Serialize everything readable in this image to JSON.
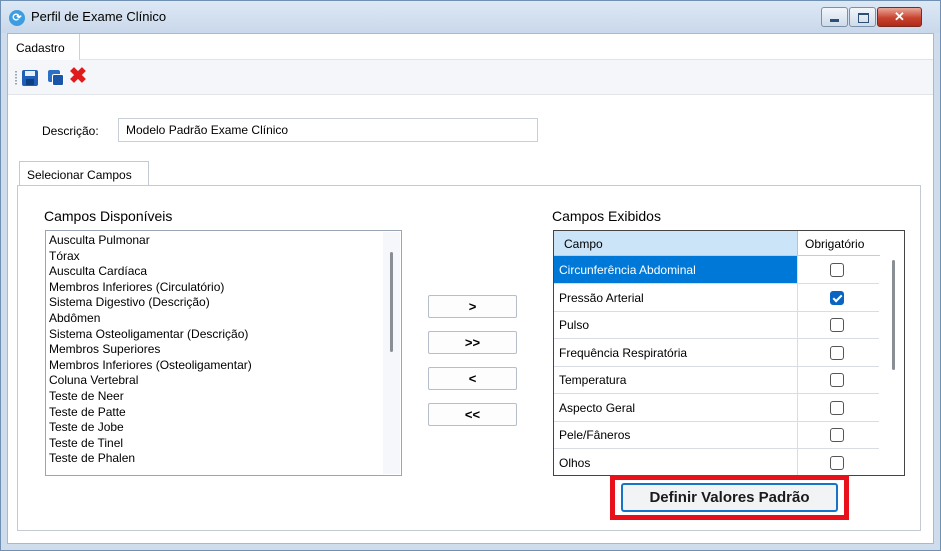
{
  "window": {
    "title": "Perfil de Exame Clínico",
    "min_glyph": "",
    "close_glyph": "✕"
  },
  "menu": {
    "tab_label": "Cadastro"
  },
  "toolbar": {
    "icons": [
      "save-icon",
      "save-and-close-icon",
      "delete-icon"
    ],
    "delete_glyph": "✖"
  },
  "descricao": {
    "label": "Descrição:",
    "value": "Modelo Padrão Exame Clínico"
  },
  "tabs": [
    {
      "label": "Selecionar Campos"
    }
  ],
  "disponiveis": {
    "title": "Campos Disponíveis",
    "items": [
      "Ausculta Pulmonar",
      "Tórax",
      "Ausculta Cardíaca",
      "Membros Inferiores (Circulatório)",
      "Sistema Digestivo (Descrição)",
      "Abdômen",
      "Sistema Osteoligamentar (Descrição)",
      "Membros Superiores",
      "Membros Inferiores (Osteoligamentar)",
      "Coluna Vertebral",
      "Teste de Neer",
      "Teste de Patte",
      "Teste de Jobe",
      "Teste de Tinel",
      "Teste de Phalen"
    ]
  },
  "move_buttons": {
    "add": ">",
    "add_all": ">>",
    "remove": "<",
    "remove_all": "<<"
  },
  "exibidos": {
    "title": "Campos Exibidos",
    "columns": {
      "campo": "Campo",
      "obrigatorio": "Obrigatório"
    },
    "rows": [
      {
        "campo": "Circunferência Abdominal",
        "obrigatorio": false,
        "selected": true
      },
      {
        "campo": "Pressão Arterial",
        "obrigatorio": true,
        "selected": false
      },
      {
        "campo": "Pulso",
        "obrigatorio": false,
        "selected": false
      },
      {
        "campo": "Frequência Respiratória",
        "obrigatorio": false,
        "selected": false
      },
      {
        "campo": "Temperatura",
        "obrigatorio": false,
        "selected": false
      },
      {
        "campo": "Aspecto Geral",
        "obrigatorio": false,
        "selected": false
      },
      {
        "campo": "Pele/Fâneros",
        "obrigatorio": false,
        "selected": false
      },
      {
        "campo": "Olhos",
        "obrigatorio": false,
        "selected": false
      }
    ]
  },
  "actions": {
    "definir_label": "Definir Valores Padrão"
  },
  "colors": {
    "selection": "#0078d7",
    "highlight": "#e8101a",
    "header_campo": "#cce4f7",
    "checkbox_checked": "#0a64c2"
  }
}
